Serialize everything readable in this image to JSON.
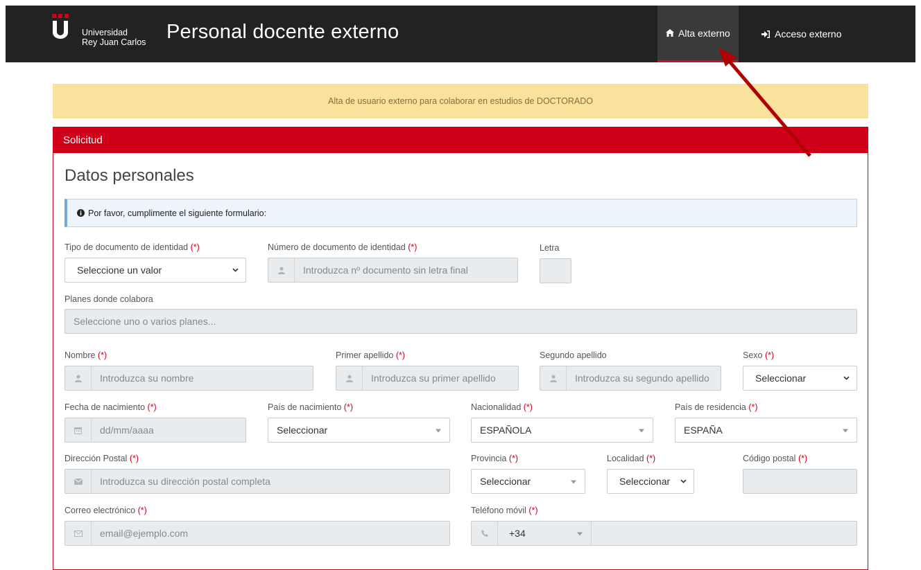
{
  "header": {
    "brand_line1": "Universidad",
    "brand_line2": "Rey Juan Carlos",
    "title": "Personal docente externo",
    "nav": [
      {
        "label": "Alta externo",
        "icon": "home-icon"
      },
      {
        "label": "Acceso externo",
        "icon": "sign-in-icon"
      }
    ]
  },
  "alert": {
    "text": "Alta de usuario externo para colaborar en estudios de DOCTORADO"
  },
  "panel": {
    "heading": "Solicitud"
  },
  "section": {
    "title": "Datos personales"
  },
  "info": {
    "text": "Por favor, cumplimente el siguiente formulario:"
  },
  "required_mark": "(*)",
  "form": {
    "tipo_doc": {
      "label": "Tipo de documento de identidad",
      "value": "Seleccione un valor"
    },
    "num_doc": {
      "label": "Número de documento de identidad",
      "placeholder": "Introduzca nº documento sin letra final"
    },
    "letra": {
      "label": "Letra"
    },
    "planes": {
      "label": "Planes donde colabora",
      "placeholder": "Seleccione uno o varios planes..."
    },
    "nombre": {
      "label": "Nombre",
      "placeholder": "Introduzca su nombre"
    },
    "primer_apellido": {
      "label": "Primer apellido",
      "placeholder": "Introduzca su primer apellido"
    },
    "segundo_apellido": {
      "label": "Segundo apellido",
      "placeholder": "Introduzca su segundo apellido"
    },
    "sexo": {
      "label": "Sexo",
      "value": "Seleccionar"
    },
    "fecha_nac": {
      "label": "Fecha de nacimiento",
      "placeholder": "dd/mm/aaaa"
    },
    "pais_nac": {
      "label": "País de nacimiento",
      "value": "Seleccionar"
    },
    "nacionalidad": {
      "label": "Nacionalidad",
      "value": "ESPAÑOLA"
    },
    "pais_res": {
      "label": "País de residencia",
      "value": "ESPAÑA"
    },
    "direccion": {
      "label": "Dirección Postal",
      "placeholder": "Introduzca su dirección postal completa"
    },
    "provincia": {
      "label": "Provincia",
      "value": "Seleccionar"
    },
    "localidad": {
      "label": "Localidad",
      "value": "Seleccionar"
    },
    "cp": {
      "label": "Código postal"
    },
    "email": {
      "label": "Correo electrónico",
      "placeholder": "email@ejemplo.com"
    },
    "telefono": {
      "label": "Teléfono móvil",
      "prefix": "+34"
    }
  },
  "colors": {
    "brand_red": "#d0001b",
    "topbar": "#222222",
    "annotation_arrow": "#b00000"
  }
}
